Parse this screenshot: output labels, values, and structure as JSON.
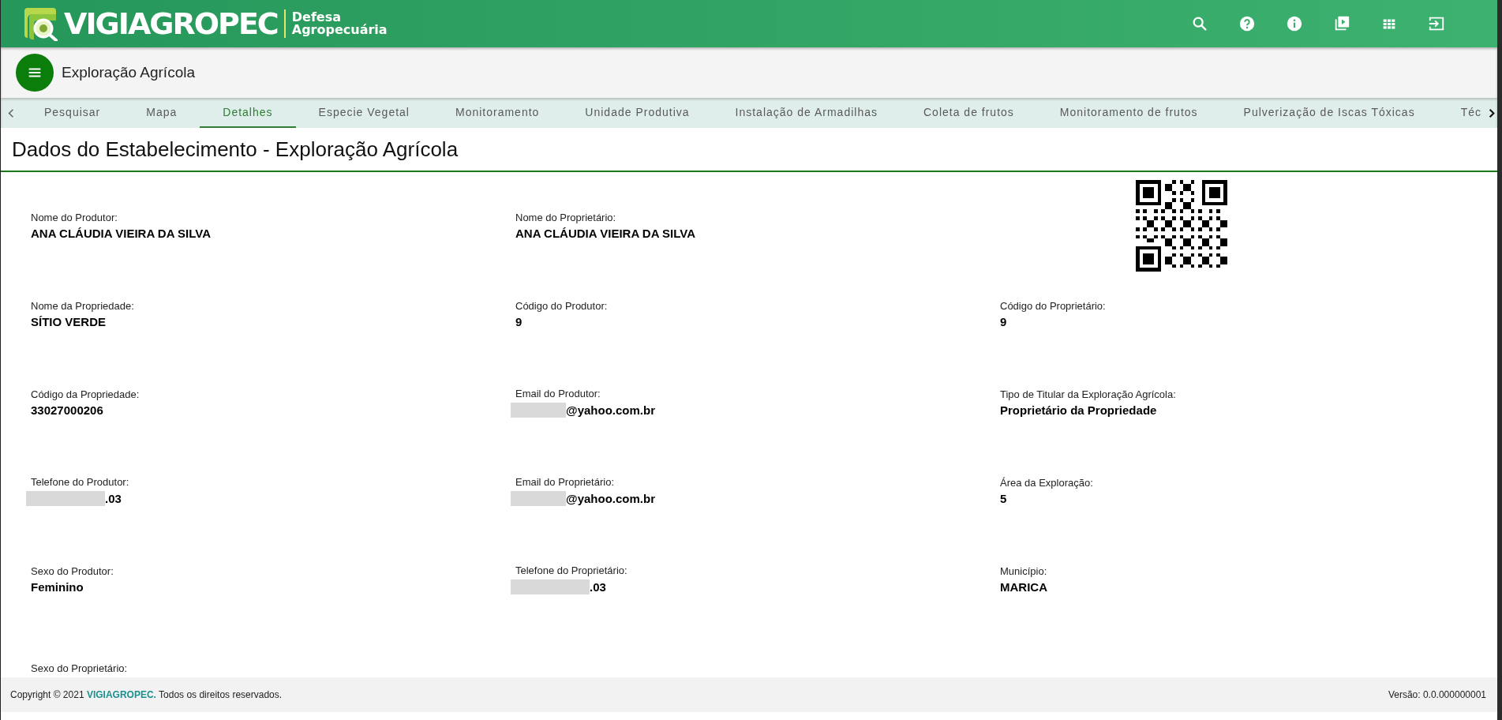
{
  "header": {
    "logo_name": "VIGIAGROPEC",
    "logo_tagline_1": "Defesa",
    "logo_tagline_2": "Agropecuária"
  },
  "title_bar": {
    "title": "Exploração Agrícola"
  },
  "tabs": [
    {
      "label": "Pesquisar",
      "selected": false
    },
    {
      "label": "Mapa",
      "selected": false
    },
    {
      "label": "Detalhes",
      "selected": true
    },
    {
      "label": "Especie Vegetal",
      "selected": false
    },
    {
      "label": "Monitoramento",
      "selected": false
    },
    {
      "label": "Unidade Produtiva",
      "selected": false
    },
    {
      "label": "Instalação de Armadilhas",
      "selected": false
    },
    {
      "label": "Coleta de frutos",
      "selected": false
    },
    {
      "label": "Monitoramento de frutos",
      "selected": false
    },
    {
      "label": "Pulverização de Iscas Tóxicas",
      "selected": false
    },
    {
      "label": "Téc",
      "selected": false
    }
  ],
  "page_title": "Dados do Estabelecimento - Exploração Agrícola",
  "fields": [
    {
      "kind": "text",
      "label": "Nome do Produtor:",
      "value": "ANA CLÁUDIA VIEIRA DA SILVA",
      "redacted": false
    },
    {
      "kind": "text",
      "label": "Nome do Proprietário:",
      "value": "ANA CLÁUDIA VIEIRA DA SILVA",
      "redacted": false
    },
    {
      "kind": "qr"
    },
    {
      "kind": "text",
      "label": "Nome da Propriedade:",
      "value": "SÍTIO VERDE",
      "redacted": false
    },
    {
      "kind": "text",
      "label": "Código do Produtor:",
      "value": "9",
      "redacted": false
    },
    {
      "kind": "text",
      "label": "Código do Proprietário:",
      "value": "9",
      "redacted": false
    },
    {
      "kind": "text",
      "label": "Código da Propriedade:",
      "value": "33027000206",
      "redacted": false
    },
    {
      "kind": "text",
      "label": "Email do Produtor:",
      "value": "@yahoo.com.br",
      "redacted": true
    },
    {
      "kind": "text",
      "label": "Tipo de Titular da Exploração Agrícola:",
      "value": "Proprietário da Propriedade",
      "redacted": false
    },
    {
      "kind": "text",
      "label": "Telefone do Produtor:",
      "value": ".03",
      "redacted": true
    },
    {
      "kind": "text",
      "label": "Email do Proprietário:",
      "value": "@yahoo.com.br",
      "redacted": true
    },
    {
      "kind": "text",
      "label": "Área da Exploração:",
      "value": "5",
      "redacted": false
    },
    {
      "kind": "text",
      "label": "Sexo do Produtor:",
      "value": "Feminino",
      "redacted": false
    },
    {
      "kind": "text",
      "label": "Telefone do Proprietário:",
      "value": ".03",
      "redacted": true
    },
    {
      "kind": "text",
      "label": "Município:",
      "value": "MARICA",
      "redacted": false
    },
    {
      "kind": "text",
      "label": "Sexo do Proprietário:"
    }
  ],
  "footer": {
    "copyright": "Copyright © 2021 **VIGIAGROPEC.** Todos os direitos reservados.",
    "version": "Versão: 0.0.000000001"
  }
}
